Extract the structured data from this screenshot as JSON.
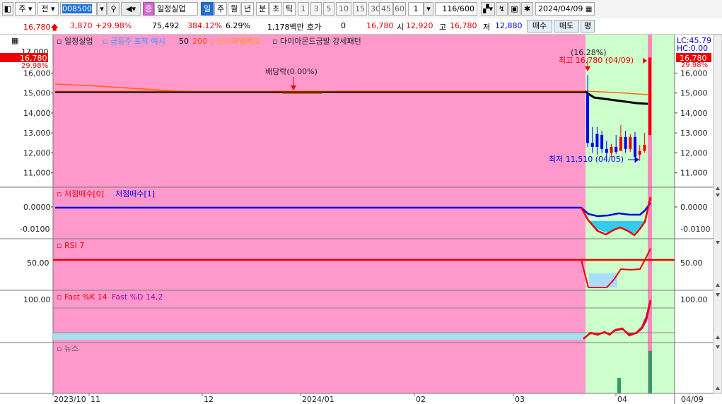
{
  "toolbar": {
    "market": "주",
    "prev": "전",
    "code": "008500",
    "name": "일정실업",
    "badge": "증",
    "periods": [
      "일",
      "주",
      "월",
      "년",
      "분",
      "초",
      "틱"
    ],
    "active_period": "일",
    "intervals": [
      "1",
      "3",
      "5",
      "10",
      "15",
      "30",
      "45",
      "60"
    ],
    "interval_value": "1",
    "count": "116",
    "count_total": "/600",
    "date": "2024/04/09"
  },
  "quote": {
    "price": "16,780",
    "change": "3,870",
    "change_pct": "+29.98%",
    "volume": "75,492",
    "volume_ratio": "384.12%",
    "turnover_pct": "6.29%",
    "amount": "1,178백만",
    "hoga_label": "호가",
    "hoga_value": "0",
    "hoga_price": "16,780",
    "open_label": "시",
    "open": "12,920",
    "high_label": "고",
    "high": "16,780",
    "low_label": "저",
    "low": "12,880",
    "buy_btn": "매수",
    "sell_btn": "매도",
    "avg_btn": "평"
  },
  "legend": {
    "name": "일정실업",
    "rapid_signal": "급등주 포착 예시",
    "ma50": "50",
    "ma200": "200",
    "short_overheat": "단기과열예고",
    "diamond": "다이아몬드금발 강세패턴"
  },
  "price_panel": {
    "right_lc": "LC:45.79",
    "right_hc": "HC:0.00",
    "current_box": "16,780",
    "current_pct": "29.98%",
    "left_current_box": "16,780",
    "left_current_pct": "29.98%",
    "left_top_tick": "17,000",
    "ticks": [
      "16,000",
      "15,000",
      "14,000",
      "13,000",
      "12,000",
      "11,000"
    ],
    "dividend": "배당락(0.00%)",
    "max_pct": "(16.28%)",
    "max_label": "최고 16,780 (04/09)",
    "min_label": "최저 11,510 (04/05)"
  },
  "low_panel": {
    "title1": "저점매수[0]",
    "title2": "저점매수[1]",
    "ticks": [
      "0.0000",
      "-0.0100"
    ]
  },
  "rsi_panel": {
    "title": "RSI 7",
    "tick": "50.00"
  },
  "stoch_panel": {
    "title1": "Fast %K 14",
    "title2": "Fast %D 14,2",
    "tick": "100.00"
  },
  "news_panel": {
    "title": "뉴스"
  },
  "xaxis": {
    "labels": [
      "2023/10",
      "11",
      "12",
      "2024/01",
      "02",
      "03",
      "04"
    ],
    "right_label": "04/09"
  },
  "colors": {
    "pink_bg": "#ff99cc",
    "green_bg": "#ccffcc",
    "up": "#ee0000",
    "down": "#0000ee",
    "ma_black": "#000000",
    "ma_orange": "#ff6600"
  },
  "chart_data": {
    "type": "candlestick",
    "ylim": [
      10500,
      17200
    ],
    "flat_price": 14920,
    "candles": [
      {
        "o": 14950,
        "h": 15900,
        "l": 12300,
        "c": 12500,
        "up": false
      },
      {
        "o": 12500,
        "h": 13300,
        "l": 12000,
        "c": 12300,
        "up": false
      },
      {
        "o": 12300,
        "h": 13300,
        "l": 11900,
        "c": 12950,
        "up": false
      },
      {
        "o": 12900,
        "h": 13100,
        "l": 12000,
        "c": 12200,
        "up": false
      },
      {
        "o": 12200,
        "h": 12600,
        "l": 11800,
        "c": 12000,
        "up": false
      },
      {
        "o": 12000,
        "h": 12450,
        "l": 11800,
        "c": 12300,
        "up": true
      },
      {
        "o": 12300,
        "h": 12900,
        "l": 11950,
        "c": 12050,
        "up": false
      },
      {
        "o": 12100,
        "h": 13400,
        "l": 12100,
        "c": 12800,
        "up": true
      },
      {
        "o": 12800,
        "h": 13100,
        "l": 12000,
        "c": 12200,
        "up": false
      },
      {
        "o": 12200,
        "h": 12950,
        "l": 12050,
        "c": 12800,
        "up": true
      },
      {
        "o": 12800,
        "h": 13050,
        "l": 11510,
        "c": 11800,
        "up": false
      },
      {
        "o": 11900,
        "h": 12400,
        "l": 11600,
        "c": 12100,
        "up": true
      },
      {
        "o": 12100,
        "h": 13000,
        "l": 12000,
        "c": 12400,
        "up": true
      },
      {
        "o": 12900,
        "h": 16780,
        "l": 12880,
        "c": 16780,
        "up": true
      }
    ]
  }
}
